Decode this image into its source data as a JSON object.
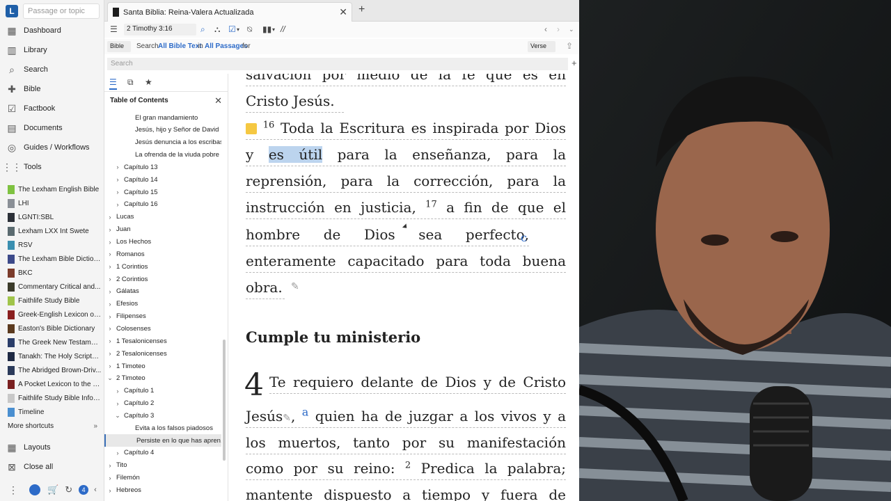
{
  "sidebar": {
    "search_placeholder": "Passage or topic",
    "nav": [
      "Dashboard",
      "Library",
      "Search",
      "Bible",
      "Factbook",
      "Documents",
      "Guides / Workflows",
      "Tools"
    ],
    "shortcuts": [
      {
        "label": "The Lexham English Bible",
        "color": "#7fc241"
      },
      {
        "label": "LHI",
        "color": "#8a8f96"
      },
      {
        "label": "LGNTI:SBL",
        "color": "#2c3038"
      },
      {
        "label": "Lexham LXX Int Swete",
        "color": "#5a6a6f"
      },
      {
        "label": "RSV",
        "color": "#3a8fb0"
      },
      {
        "label": "The Lexham Bible Diction...",
        "color": "#3d4a8a"
      },
      {
        "label": "BKC",
        "color": "#7b3b2b"
      },
      {
        "label": "Commentary Critical and...",
        "color": "#3b3b2a"
      },
      {
        "label": "Faithlife Study Bible",
        "color": "#a0c44a"
      },
      {
        "label": "Greek-English Lexicon of t...",
        "color": "#8a1f1f"
      },
      {
        "label": "Easton's Bible Dictionary",
        "color": "#5b3a1f"
      },
      {
        "label": "The Greek New Testament...",
        "color": "#2b3e6a"
      },
      {
        "label": "Tanakh: The Holy Scriptur...",
        "color": "#1f2a44"
      },
      {
        "label": "The Abridged Brown-Driv...",
        "color": "#2b3a5a"
      },
      {
        "label": "A Pocket Lexicon to the Gr...",
        "color": "#7a2020"
      },
      {
        "label": "Faithlife Study Bible Infog...",
        "color": "#c8c8c8"
      },
      {
        "label": "Timeline",
        "color": "#4a8fd0"
      }
    ],
    "more_shortcuts": "More shortcuts",
    "layouts": "Layouts",
    "close_all": "Close all",
    "badge": "4"
  },
  "tab": {
    "title": "Santa Biblia: Reina-Valera Actualizada"
  },
  "toolbar": {
    "reference": "2 Timothy 3:16",
    "parallel": "//"
  },
  "searchline": {
    "bible_dd": "Bible",
    "prefix": "Search",
    "scope": "All Bible Text",
    "in": "in",
    "range": "All Passages",
    "for": "for",
    "verse_dd": "Verse"
  },
  "search_field": {
    "placeholder": "Search"
  },
  "toc": {
    "title": "Table of Contents",
    "rows": [
      {
        "label": "El gran mandamiento",
        "level": 3,
        "chev": ""
      },
      {
        "label": "Jesús, hijo y Señor de David",
        "level": 3,
        "chev": ""
      },
      {
        "label": "Jesús denuncia a los escribas",
        "level": 3,
        "chev": ""
      },
      {
        "label": "La ofrenda de la viuda pobre",
        "level": 3,
        "chev": ""
      },
      {
        "label": "Capítulo 13",
        "level": 2,
        "chev": "›"
      },
      {
        "label": "Capítulo 14",
        "level": 2,
        "chev": "›"
      },
      {
        "label": "Capítulo 15",
        "level": 2,
        "chev": "›"
      },
      {
        "label": "Capítulo 16",
        "level": 2,
        "chev": "›"
      },
      {
        "label": "Lucas",
        "level": 1,
        "chev": "›"
      },
      {
        "label": "Juan",
        "level": 1,
        "chev": "›"
      },
      {
        "label": "Los Hechos",
        "level": 1,
        "chev": "›"
      },
      {
        "label": "Romanos",
        "level": 1,
        "chev": "›"
      },
      {
        "label": "1 Corintios",
        "level": 1,
        "chev": "›"
      },
      {
        "label": "2 Corintios",
        "level": 1,
        "chev": "›"
      },
      {
        "label": "Gálatas",
        "level": 1,
        "chev": "›"
      },
      {
        "label": "Efesios",
        "level": 1,
        "chev": "›"
      },
      {
        "label": "Filipenses",
        "level": 1,
        "chev": "›"
      },
      {
        "label": "Colosenses",
        "level": 1,
        "chev": "›"
      },
      {
        "label": "1 Tesalonicenses",
        "level": 1,
        "chev": "›"
      },
      {
        "label": "2 Tesalonicenses",
        "level": 1,
        "chev": "›"
      },
      {
        "label": "1 Timoteo",
        "level": 1,
        "chev": "›"
      },
      {
        "label": "2 Timoteo",
        "level": 1,
        "chev": "⌄"
      },
      {
        "label": "Capítulo 1",
        "level": 2,
        "chev": "›"
      },
      {
        "label": "Capítulo 2",
        "level": 2,
        "chev": "›"
      },
      {
        "label": "Capítulo 3",
        "level": 2,
        "chev": "⌄"
      },
      {
        "label": "Evita a los falsos piadosos",
        "level": 3,
        "chev": ""
      },
      {
        "label": "Persiste en lo que has apren...",
        "level": 3,
        "chev": "",
        "selected": true
      },
      {
        "label": "Capítulo 4",
        "level": 2,
        "chev": "›"
      },
      {
        "label": "Tito",
        "level": 1,
        "chev": "›"
      },
      {
        "label": "Filemón",
        "level": 1,
        "chev": "›"
      },
      {
        "label": "Hebreos",
        "level": 1,
        "chev": "›"
      }
    ]
  },
  "reader": {
    "l1": "salvación por medio de la fe que es en",
    "l2": "Cristo Jesús.",
    "v16": "16",
    "l3": "Toda la Escritura es inspirada por Dios",
    "l4_a": "y",
    "l4_hl": "es útil",
    "l4_b": "para la enseñanza, para la",
    "l5": "reprensión, para la corrección, para la",
    "l6_a": "instrucción en justicia,",
    "v17": "17",
    "l6_b": "a fin de que el",
    "l7": "hombre de Dios sea perfecto,",
    "note_c": "c",
    "l8": "enteramente capacitado para toda buena",
    "l9": "obra.",
    "heading": "Cumple tu ministerio",
    "ch4": "4",
    "l10": "Te requiero delante de Dios y de Cristo",
    "l11_a": "Jesús",
    "note_a": "a",
    "l11_b": "quien ha de juzgar a los vivos y a",
    "l12": "los muertos, tanto por su manifestación",
    "l13_a": "como por su reino:",
    "v2": "2",
    "l13_b": "Predica la palabra;",
    "l14": "mantente dispuesto a tiempo y fuera de"
  },
  "colors": {
    "accent": "#1f5fa8",
    "highlight": "#bcd4ee",
    "note_link": "#2d6bc8",
    "sticky_note": "#f5c842"
  }
}
